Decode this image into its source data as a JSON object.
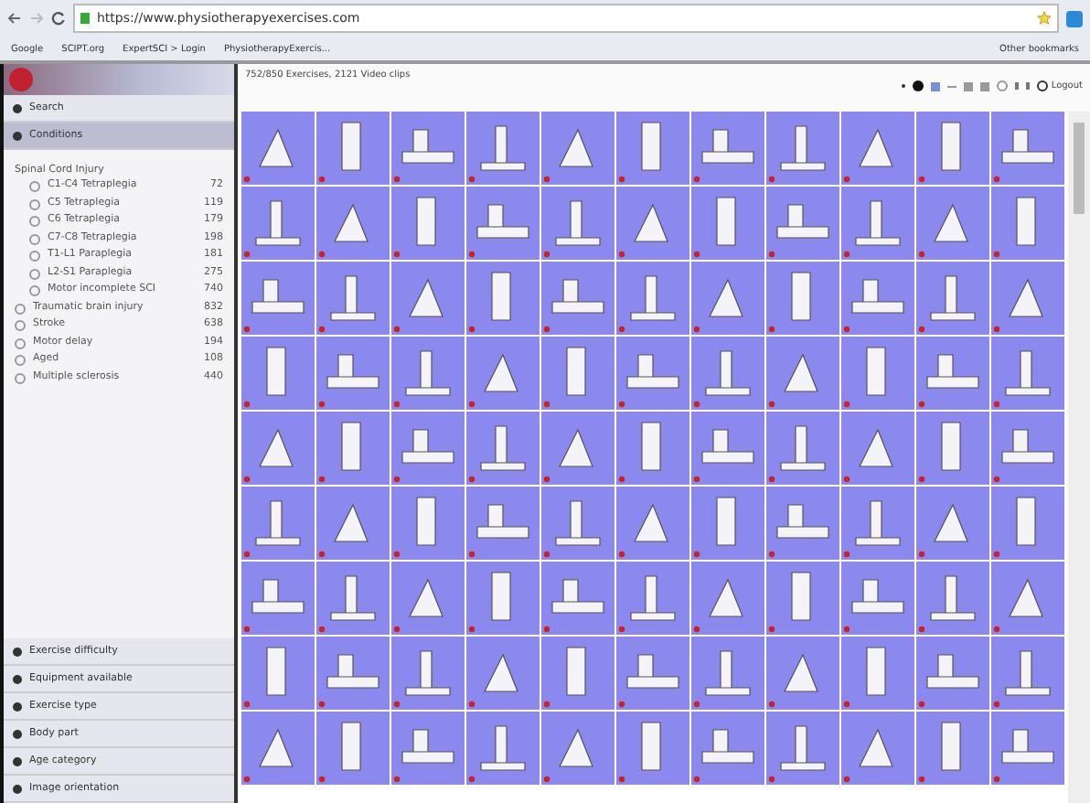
{
  "browser": {
    "url": "https://www.physiotherapyexercises.com",
    "bookmarks": [
      "Google",
      "SCIPT.org",
      "ExpertSCI > Login",
      "PhysiotherapyExercis..."
    ],
    "other_bookmarks": "Other bookmarks"
  },
  "sidebar": {
    "search": "Search",
    "sections_top": [
      {
        "label": "Conditions",
        "expanded": true
      }
    ],
    "conditions": [
      {
        "label": "Spinal Cord Injury",
        "children": [
          {
            "label": "C1-C4 Tetraplegia",
            "count": "72",
            "selected": false
          },
          {
            "label": "C5 Tetraplegia",
            "count": "119",
            "selected": false
          },
          {
            "label": "C6 Tetraplegia",
            "count": "179",
            "selected": false
          },
          {
            "label": "C7-C8 Tetraplegia",
            "count": "198",
            "selected": false
          },
          {
            "label": "T1-L1 Paraplegia",
            "count": "181",
            "selected": false
          },
          {
            "label": "L2-S1 Paraplegia",
            "count": "275",
            "selected": false
          },
          {
            "label": "Motor incomplete SCI",
            "count": "740",
            "selected": false
          }
        ]
      },
      {
        "label": "Traumatic brain injury",
        "count": "832",
        "selected": false
      },
      {
        "label": "Stroke",
        "count": "638",
        "selected": false
      },
      {
        "label": "Motor delay",
        "count": "194",
        "selected": false
      },
      {
        "label": "Aged",
        "count": "108",
        "selected": false
      },
      {
        "label": "Multiple sclerosis",
        "count": "440",
        "selected": false
      }
    ],
    "sections_bottom": [
      "Exercise difficulty",
      "Equipment available",
      "Exercise type",
      "Body part",
      "Age category",
      "Image orientation"
    ]
  },
  "main": {
    "summary": "752/850 Exercises, 2121 Video clips",
    "logout": "Logout"
  }
}
